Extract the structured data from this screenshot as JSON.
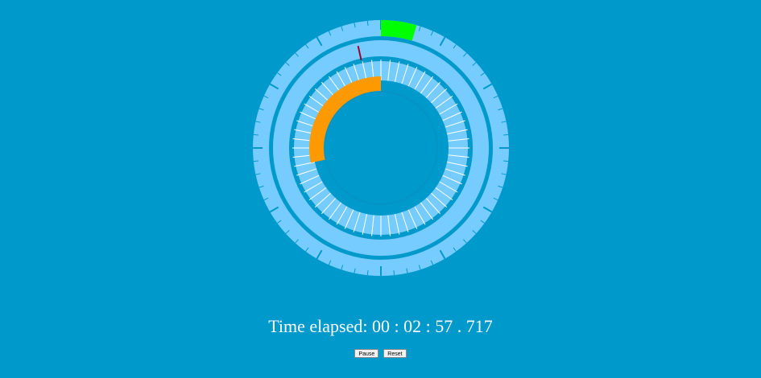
{
  "stopwatch": {
    "label": "Time elapsed:",
    "hours": "00",
    "minutes": "02",
    "seconds": "57",
    "milliseconds": "717",
    "separator": ":",
    "ms_separator": "."
  },
  "controls": {
    "pause_label": "Pause",
    "reset_label": "Reset"
  },
  "dial": {
    "minute_progress_fraction": 0.045,
    "second_progress_fraction": 0.717,
    "ms_hand_fraction": 0.965,
    "inner_tick_count": 60,
    "outer_tick_count": 60
  },
  "colors": {
    "background": "#0099cc",
    "ring": "#77ccff",
    "tick": "#0099cc",
    "minute_progress": "#00ff00",
    "second_progress": "#ff9900",
    "ms_hand": "#990033",
    "text": "#ffffff"
  }
}
